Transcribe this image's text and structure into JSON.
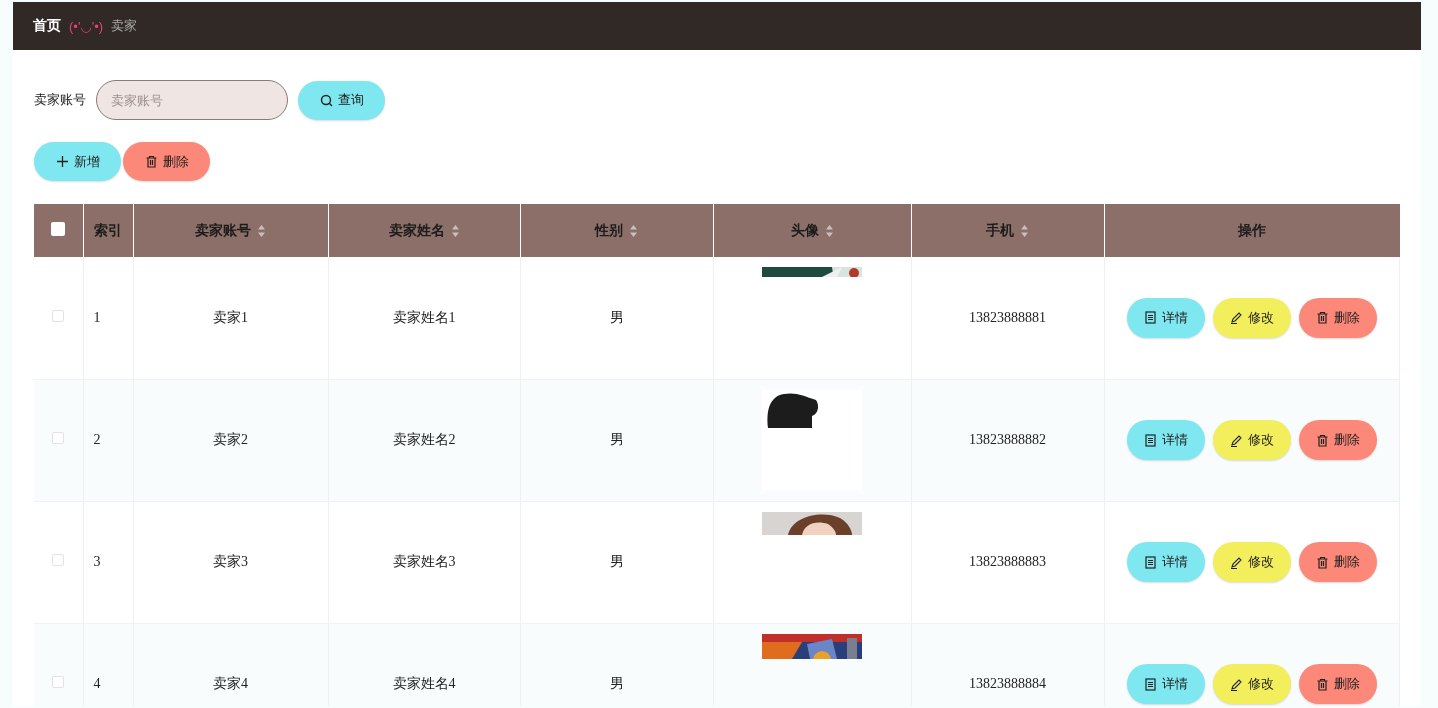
{
  "breadcrumb": {
    "home": "首页",
    "separator": "(•'◡'•)",
    "current": "卖家"
  },
  "search": {
    "label": "卖家账号",
    "placeholder": "卖家账号",
    "button": "查询"
  },
  "toolbar": [
    {
      "kind": "add",
      "label": "新增"
    },
    {
      "kind": "delete",
      "label": "删除"
    }
  ],
  "table": {
    "select_all": {
      "checked": false
    },
    "columns": [
      {
        "label": "索引",
        "sortable": false
      },
      {
        "label": "卖家账号",
        "sortable": true
      },
      {
        "label": "卖家姓名",
        "sortable": true
      },
      {
        "label": "性别",
        "sortable": true
      },
      {
        "label": "头像",
        "sortable": true
      },
      {
        "label": "手机",
        "sortable": true
      },
      {
        "label": "操作",
        "sortable": false
      }
    ],
    "rows": [
      {
        "checked": false,
        "index": "1",
        "account": "卖家1",
        "name": "卖家姓名1",
        "gender": "男",
        "avatar": {
          "kind": "picture"
        },
        "phone": "13823888881",
        "actions": [
          {
            "kind": "detail",
            "label": "详情"
          },
          {
            "kind": "edit",
            "label": "修改"
          },
          {
            "kind": "delete",
            "label": "删除"
          }
        ]
      },
      {
        "checked": false,
        "index": "2",
        "account": "卖家2",
        "name": "卖家姓名2",
        "gender": "男",
        "avatar": {
          "kind": "picture"
        },
        "phone": "13823888882",
        "actions": [
          {
            "kind": "detail",
            "label": "详情"
          },
          {
            "kind": "edit",
            "label": "修改"
          },
          {
            "kind": "delete",
            "label": "删除"
          }
        ]
      },
      {
        "checked": false,
        "index": "3",
        "account": "卖家3",
        "name": "卖家姓名3",
        "gender": "男",
        "avatar": {
          "kind": "picture"
        },
        "phone": "13823888883",
        "actions": [
          {
            "kind": "detail",
            "label": "详情"
          },
          {
            "kind": "edit",
            "label": "修改"
          },
          {
            "kind": "delete",
            "label": "删除"
          }
        ]
      },
      {
        "checked": false,
        "index": "4",
        "account": "卖家4",
        "name": "卖家姓名4",
        "gender": "男",
        "avatar": {
          "kind": "picture"
        },
        "phone": "13823888884",
        "actions": [
          {
            "kind": "detail",
            "label": "详情"
          },
          {
            "kind": "edit",
            "label": "修改"
          },
          {
            "kind": "delete",
            "label": "删除"
          }
        ]
      }
    ]
  }
}
